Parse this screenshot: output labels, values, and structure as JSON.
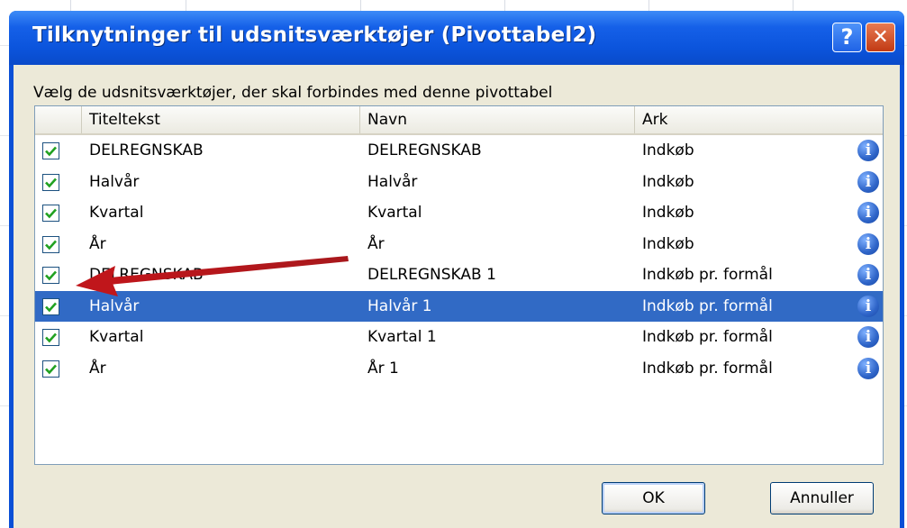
{
  "dialog": {
    "title": "Tilknytninger til udsnitsværktøjer (Pivottabel2)",
    "help_label": "?",
    "close_label": "✕",
    "instruction": "Vælg de udsnitsværktøjer, der skal forbindes med denne pivottabel"
  },
  "columns": {
    "col1": "Titeltekst",
    "col2": "Navn",
    "col3": "Ark"
  },
  "rows": [
    {
      "checked": true,
      "title": "DELREGNSKAB",
      "name": "DELREGNSKAB",
      "sheet": "Indkøb",
      "selected": false
    },
    {
      "checked": true,
      "title": "Halvår",
      "name": "Halvår",
      "sheet": "Indkøb",
      "selected": false
    },
    {
      "checked": true,
      "title": "Kvartal",
      "name": "Kvartal",
      "sheet": "Indkøb",
      "selected": false
    },
    {
      "checked": true,
      "title": "År",
      "name": "År",
      "sheet": "Indkøb",
      "selected": false
    },
    {
      "checked": true,
      "title": "DELREGNSKAB",
      "name": "DELREGNSKAB 1",
      "sheet": "Indkøb pr. formål",
      "selected": false
    },
    {
      "checked": true,
      "title": "Halvår",
      "name": "Halvår 1",
      "sheet": "Indkøb pr. formål",
      "selected": true
    },
    {
      "checked": true,
      "title": "Kvartal",
      "name": "Kvartal 1",
      "sheet": "Indkøb pr. formål",
      "selected": false
    },
    {
      "checked": true,
      "title": "År",
      "name": "År 1",
      "sheet": "Indkøb pr. formål",
      "selected": false
    }
  ],
  "info_icon_glyph": "i",
  "buttons": {
    "ok": "OK",
    "cancel": "Annuller"
  },
  "colors": {
    "title_bar": "#0a4fd6",
    "selection": "#316ac5",
    "checkmark": "#21a121",
    "annotation_arrow": "#c0161b"
  }
}
